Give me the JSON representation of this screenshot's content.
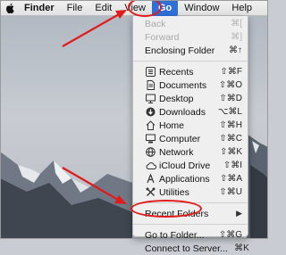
{
  "menubar": {
    "apple_icon": "apple-logo-icon",
    "items": [
      "Finder",
      "File",
      "Edit",
      "View",
      "Go",
      "Window",
      "Help"
    ]
  },
  "go_menu": {
    "back": {
      "label": "Back",
      "shortcut": "⌘["
    },
    "forward": {
      "label": "Forward",
      "shortcut": "⌘]"
    },
    "enclosing": {
      "label": "Enclosing Folder",
      "shortcut": "⌘↑"
    },
    "recents": {
      "label": "Recents",
      "shortcut": "⇧⌘F"
    },
    "documents": {
      "label": "Documents",
      "shortcut": "⇧⌘O"
    },
    "desktop": {
      "label": "Desktop",
      "shortcut": "⇧⌘D"
    },
    "downloads": {
      "label": "Downloads",
      "shortcut": "⌥⌘L"
    },
    "home": {
      "label": "Home",
      "shortcut": "⇧⌘H"
    },
    "computer": {
      "label": "Computer",
      "shortcut": "⇧⌘C"
    },
    "network": {
      "label": "Network",
      "shortcut": "⇧⌘K"
    },
    "icloud": {
      "label": "iCloud Drive",
      "shortcut": "⇧⌘I"
    },
    "applications": {
      "label": "Applications",
      "shortcut": "⇧⌘A"
    },
    "utilities": {
      "label": "Utilities",
      "shortcut": "⇧⌘U"
    },
    "recent_folders": {
      "label": "Recent Folders"
    },
    "go_to_folder": {
      "label": "Go to Folder...",
      "shortcut": "⇧⌘G"
    },
    "connect_server": {
      "label": "Connect to Server...",
      "shortcut": "⌘K"
    }
  },
  "annotation_color": "#e01b1b",
  "highlight_color": "#2f6fd8"
}
